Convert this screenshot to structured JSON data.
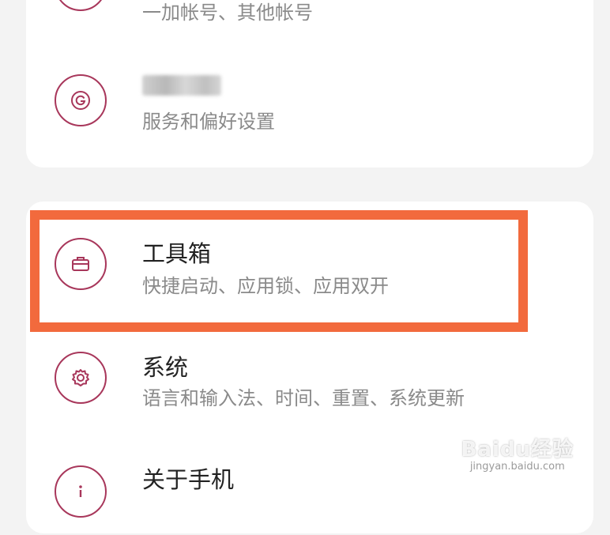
{
  "settings": {
    "account": {
      "subtitle": "一加帐号、其他帐号",
      "icon": "account-icon"
    },
    "google": {
      "subtitle": "服务和偏好设置",
      "icon": "google-icon"
    },
    "toolbox": {
      "title": "工具箱",
      "subtitle": "快捷启动、应用锁、应用双开",
      "icon": "toolbox-icon"
    },
    "system": {
      "title": "系统",
      "subtitle": "语言和输入法、时间、重置、系统更新",
      "icon": "gear-icon"
    },
    "about": {
      "title": "关于手机",
      "icon": "info-icon"
    }
  },
  "watermark": {
    "brand": "Baidu经验",
    "url": "jingyan.baidu.com"
  },
  "colors": {
    "accent": "#a8375b",
    "highlight": "#f26a3d"
  }
}
